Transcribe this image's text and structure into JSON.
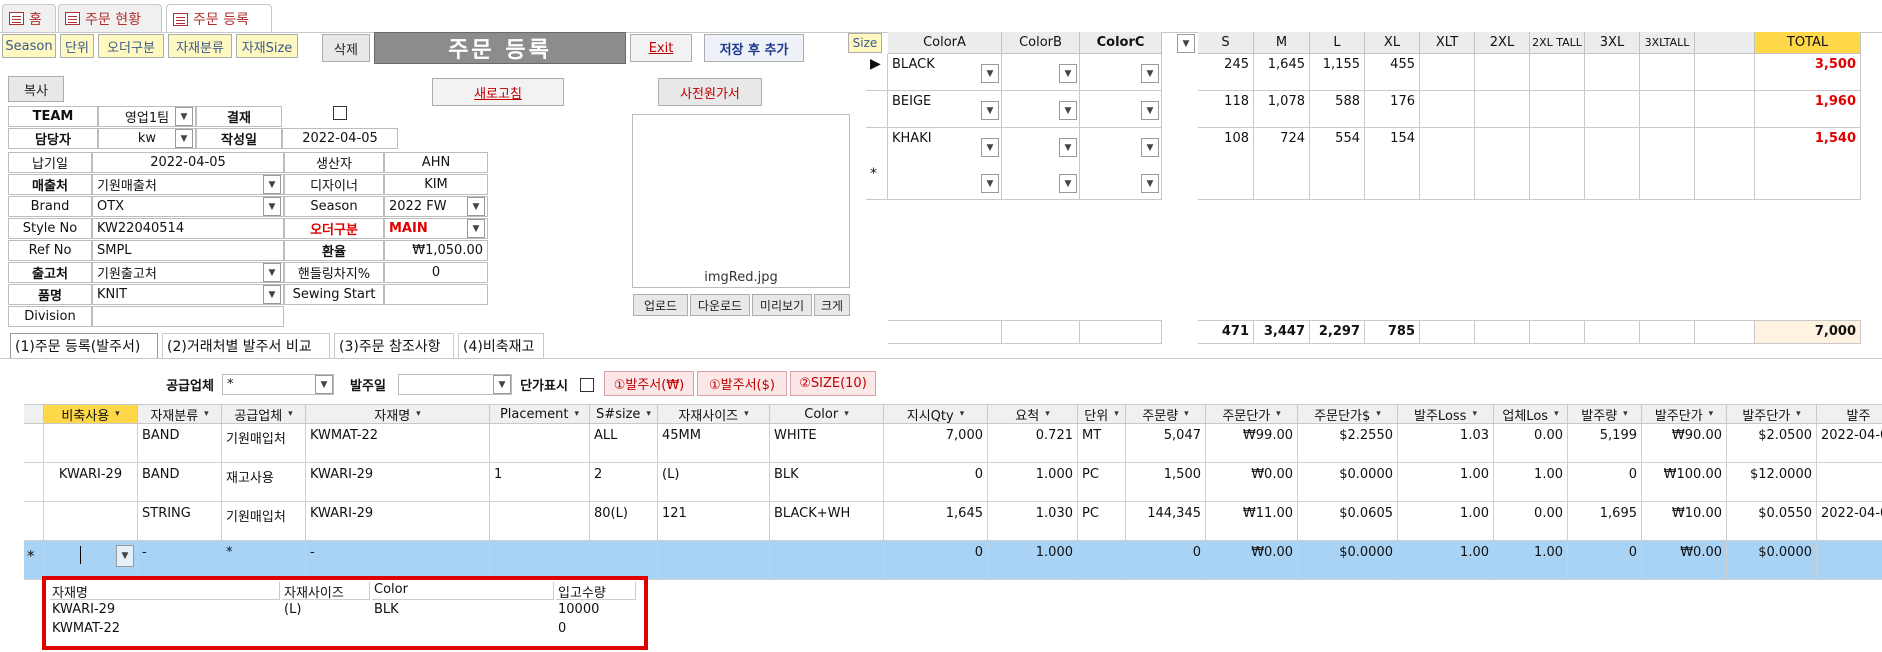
{
  "tabs": [
    {
      "label": "홈"
    },
    {
      "label": "주문 현황"
    },
    {
      "label": "주문 등록"
    }
  ],
  "toolbar": {
    "buttons": [
      "Season",
      "단위",
      "오더구분",
      "자재분류",
      "자재Size"
    ],
    "delete": "삭제",
    "title": "주문 등록",
    "exit": "Exit",
    "save_add": "저장 후 추가",
    "copy": "복사",
    "refresh": "새로고침",
    "prework": "사전원가서"
  },
  "header": {
    "team_label": "TEAM",
    "team": "영업1팀",
    "approve_label": "결재",
    "manager_label": "담당자",
    "manager": "kw",
    "created_label": "작성일",
    "created": "2022-04-05",
    "due_label": "납기일",
    "due": "2022-04-05",
    "producer_label": "생산자",
    "producer": "AHN",
    "sales_label": "매출처",
    "sales": "기원매출처",
    "designer_label": "디자이너",
    "designer": "KIM",
    "brand_label": "Brand",
    "brand": "OTX",
    "season_label": "Season",
    "season": "2022 FW",
    "style_label": "Style No",
    "style": "KW22040514",
    "ordertype_label": "오더구분",
    "ordertype": "MAIN",
    "ref_label": "Ref No",
    "ref": "SMPL",
    "rate_label": "환율",
    "rate": "₩1,050.00",
    "ship_label": "출고처",
    "ship": "기원출고처",
    "handling_label": "핸들링차지%",
    "handling": "0",
    "item_label": "품명",
    "item": "KNIT",
    "sewing_label": "Sewing Start",
    "sewing": "",
    "division_label": "Division",
    "division": ""
  },
  "image": {
    "filename": "imgRed.jpg",
    "buttons": [
      "업로드",
      "다운로드",
      "미리보기",
      "크게"
    ]
  },
  "size_grid": {
    "size_button": "Size",
    "color_headers": [
      "ColorA",
      "ColorB",
      "ColorC"
    ],
    "size_headers": [
      "S",
      "M",
      "L",
      "XL",
      "XLT",
      "2XL",
      "2XL TALL",
      "3XL",
      "3XLTALL",
      "",
      "TOTAL"
    ],
    "rows": [
      {
        "color": "BLACK",
        "sizes": [
          "245",
          "1,645",
          "1,155",
          "455",
          "",
          "",
          "",
          "",
          "",
          ""
        ],
        "total": "3,500"
      },
      {
        "color": "BEIGE",
        "sizes": [
          "118",
          "1,078",
          "588",
          "176",
          "",
          "",
          "",
          "",
          "",
          ""
        ],
        "total": "1,960"
      },
      {
        "color": "KHAKI",
        "sizes": [
          "108",
          "724",
          "554",
          "154",
          "",
          "",
          "",
          "",
          "",
          ""
        ],
        "total": "1,540"
      }
    ],
    "new_row_marker": "*",
    "totals": [
      "471",
      "3,447",
      "2,297",
      "785",
      "",
      "",
      "",
      "",
      "",
      ""
    ],
    "grand_total": "7,000"
  },
  "subtabs": [
    "(1)주문 등록(발주서)",
    "(2)거래처별 발주서 비교",
    "(3)주문 참조사항",
    "(4)비축재고"
  ],
  "filters": {
    "supplier_label": "공급업체",
    "supplier": "*",
    "orderdate_label": "발주일",
    "orderdate": "",
    "price_label": "단가표시",
    "btn_krw": "①발주서(₩)",
    "btn_usd": "①발주서($)",
    "btn_size": "②SIZE(10)"
  },
  "order_grid": {
    "columns": [
      "비축사용",
      "자재분류",
      "공급업체",
      "자재명",
      "Placement",
      "S#size",
      "자재사이즈",
      "Color",
      "지시Qty",
      "요척",
      "단위",
      "주문량",
      "주문단가",
      "주문단가$",
      "발주Loss",
      "업체Los",
      "발주량",
      "발주단가",
      "발주단가",
      "발주"
    ],
    "rows": [
      [
        "",
        "BAND",
        "기원매입처",
        "KWMAT-22",
        "",
        "ALL",
        "45MM",
        "WHITE",
        "7,000",
        "0.721",
        "MT",
        "5,047",
        "₩99.00",
        "$2.2550",
        "1.03",
        "0.00",
        "5,199",
        "₩90.00",
        "$2.0500",
        "2022-04-0"
      ],
      [
        "KWARI-29",
        "BAND",
        "재고사용",
        "KWARI-29",
        "1",
        "2",
        "(L)",
        "BLK",
        "0",
        "1.000",
        "PC",
        "1,500",
        "₩0.00",
        "$0.0000",
        "1.00",
        "1.00",
        "0",
        "₩100.00",
        "$12.0000",
        ""
      ],
      [
        "",
        "STRING",
        "기원매입처",
        "KWARI-29",
        "",
        "80(L)",
        "121",
        "BLACK+WH",
        "1,645",
        "1.030",
        "PC",
        "144,345",
        "₩11.00",
        "$0.0605",
        "1.00",
        "0.00",
        "1,695",
        "₩10.00",
        "$0.0550",
        "2022-04-0"
      ],
      [
        "",
        "-",
        "*",
        "-",
        "",
        "",
        "",
        "",
        "0",
        "1.000",
        "",
        "0",
        "₩0.00",
        "$0.0000",
        "1.00",
        "1.00",
        "0",
        "₩0.00",
        "$0.0000",
        ""
      ]
    ],
    "new_row_marker": "*"
  },
  "popup": {
    "columns": [
      "자재명",
      "자재사이즈",
      "Color",
      "입고수량"
    ],
    "rows": [
      [
        "KWARI-29",
        "(L)",
        "BLK",
        "10000"
      ],
      [
        "KWMAT-22",
        "",
        "",
        "0"
      ]
    ]
  },
  "colors": {
    "accent_red": "#e00000",
    "selected_row": "#a9d3f5",
    "header_yellow": "#ffd84a"
  }
}
